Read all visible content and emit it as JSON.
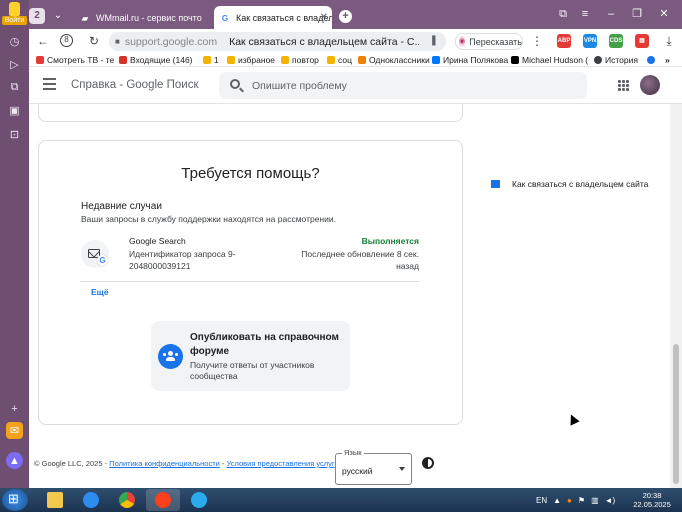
{
  "browser": {
    "rail_logo_text": "Войти",
    "tab_count": "2",
    "tabs": [
      {
        "label": "WMmail.ru - сервис почто",
        "active": false
      },
      {
        "label": "Как связаться с владелец",
        "active": true
      }
    ],
    "omnibox": {
      "domain": "support.google.com",
      "page_title": "Как связаться с владельцем сайта - С..."
    },
    "translate_label": "Пересказать",
    "extensions": [
      "ABP",
      "VPN",
      "CDS",
      "ext"
    ],
    "bookmarks": [
      {
        "label": "Смотреть ТВ - те",
        "color": "#e53935"
      },
      {
        "label": "Входящие (146)",
        "color": "#d93025"
      },
      {
        "label": "1",
        "color": "#f4b400"
      },
      {
        "label": "избраное",
        "color": "#f4b400"
      },
      {
        "label": "повтор",
        "color": "#f4b400"
      },
      {
        "label": "соц",
        "color": "#f4b400"
      },
      {
        "label": "Одноклассники",
        "color": "#ee8208"
      },
      {
        "label": "Ирина Полякова",
        "color": "#0077ff"
      },
      {
        "label": "Michael Hudson (",
        "color": "#000000"
      },
      {
        "label": "История",
        "color": "#3c4043"
      }
    ]
  },
  "header": {
    "product": "Справка - Google Поиск",
    "search_placeholder": "Опишите проблему"
  },
  "help": {
    "title": "Требуется помощь?",
    "recent_title": "Недавние случаи",
    "recent_sub": "Ваши запросы в службу поддержки находятся на рассмотрении.",
    "case": {
      "name": "Google Search",
      "id": "Идентификатор запроса 9-2048000039121",
      "status": "Выполняется",
      "updated": "Последнее обновление 8 сек. назад"
    },
    "more": "Ещё",
    "forum": {
      "title": "Опубликовать на справочном форуме",
      "sub": "Получите ответы от участников сообщества"
    }
  },
  "toc": {
    "item": "Как связаться с владельцем сайта"
  },
  "footer": {
    "copyright": "© Google LLC, 2025 -",
    "privacy": "Политика конфиденциальности",
    "sep": "-",
    "terms": "Условия предоставления услуг"
  },
  "language": {
    "label": "Язык",
    "value": "русский"
  },
  "taskbar": {
    "lang": "EN",
    "time": "20:38",
    "date": "22.05.2025"
  },
  "colors": {
    "rail": "#6e4f72",
    "accent": "#1a73e8",
    "status_green": "#188038"
  }
}
